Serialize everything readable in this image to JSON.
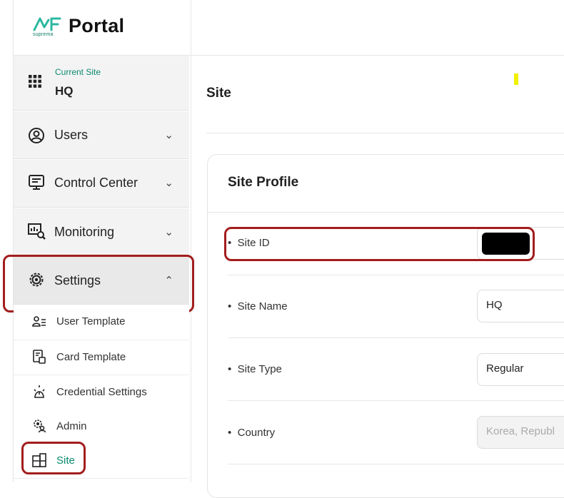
{
  "app": {
    "title": "Portal",
    "brand": "suprema"
  },
  "current_site": {
    "label": "Current Site",
    "value": "HQ"
  },
  "nav": {
    "users": "Users",
    "control_center": "Control Center",
    "monitoring": "Monitoring",
    "settings": "Settings"
  },
  "settings_items": [
    "User Template",
    "Card Template",
    "Credential Settings",
    "Admin",
    "Site"
  ],
  "main": {
    "title": "Site",
    "card_title": "Site Profile",
    "rows": [
      {
        "label": "Site ID",
        "value": ""
      },
      {
        "label": "Site Name",
        "value": "HQ"
      },
      {
        "label": "Site Type",
        "value": "Regular"
      },
      {
        "label": "Country",
        "value": "Korea, Republ"
      }
    ]
  },
  "colors": {
    "accent": "#0b8a6e",
    "highlight": "#a31d1d",
    "bullet": "•"
  }
}
